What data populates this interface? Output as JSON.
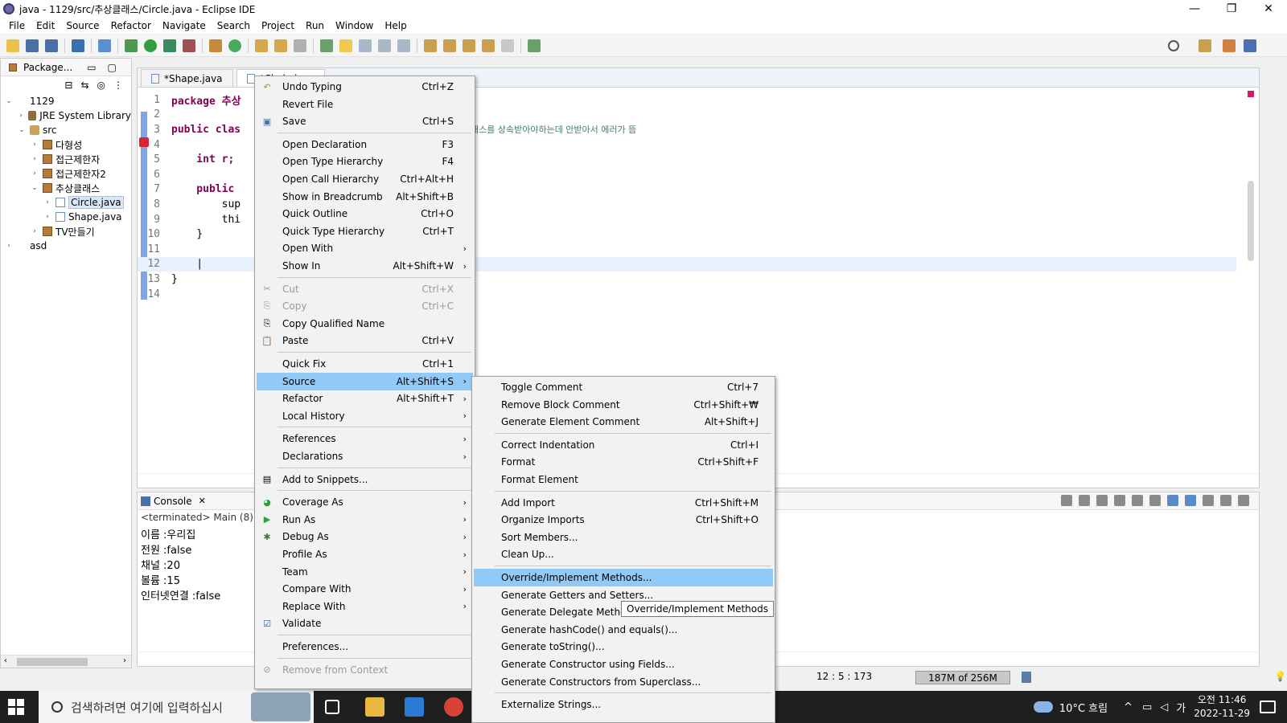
{
  "window": {
    "title": "java - 1129/src/추상클래스/Circle.java - Eclipse IDE"
  },
  "menubar": [
    "File",
    "Edit",
    "Source",
    "Refactor",
    "Navigate",
    "Search",
    "Project",
    "Run",
    "Window",
    "Help"
  ],
  "package_explorer": {
    "title": "Package...",
    "tree": [
      {
        "label": "1129",
        "indent": 0,
        "arrow": "v",
        "icon": "project"
      },
      {
        "label": "JRE System Library",
        "indent": 1,
        "arrow": ">",
        "icon": "lib"
      },
      {
        "label": "src",
        "indent": 1,
        "arrow": "v",
        "icon": "src"
      },
      {
        "label": "다형성",
        "indent": 2,
        "arrow": ">",
        "icon": "pkg"
      },
      {
        "label": "접근제한자",
        "indent": 2,
        "arrow": ">",
        "icon": "pkg"
      },
      {
        "label": "접근제한자2",
        "indent": 2,
        "arrow": ">",
        "icon": "pkg"
      },
      {
        "label": "추상클래스",
        "indent": 2,
        "arrow": "v",
        "icon": "pkg"
      },
      {
        "label": "Circle.java",
        "indent": 3,
        "arrow": ">",
        "icon": "file",
        "selected": true
      },
      {
        "label": "Shape.java",
        "indent": 3,
        "arrow": ">",
        "icon": "file"
      },
      {
        "label": "TV만들기",
        "indent": 2,
        "arrow": ">",
        "icon": "pkg"
      },
      {
        "label": "asd",
        "indent": 0,
        "arrow": ">",
        "icon": "project"
      }
    ]
  },
  "editor": {
    "tabs": [
      "*Shape.java",
      "*Circle.java"
    ],
    "lines": [
      {
        "n": "1",
        "text": "package 추상"
      },
      {
        "n": "2",
        "text": ""
      },
      {
        "n": "3",
        "text": "public clas",
        "comment": "래스를 상속받아야하는데 안받아서 에러가 뜸"
      },
      {
        "n": "4",
        "text": ""
      },
      {
        "n": "5",
        "text": "    int r;"
      },
      {
        "n": "6",
        "text": ""
      },
      {
        "n": "7",
        "text": "    public"
      },
      {
        "n": "8",
        "text": "        sup"
      },
      {
        "n": "9",
        "text": "        thi"
      },
      {
        "n": "10",
        "text": "    }"
      },
      {
        "n": "11",
        "text": ""
      },
      {
        "n": "12",
        "text": "    |"
      },
      {
        "n": "13",
        "text": "}"
      },
      {
        "n": "14",
        "text": ""
      }
    ]
  },
  "console": {
    "title": "Console",
    "terminated": "<terminated> Main (8) [Ja",
    "lines": [
      "이름 :우리집",
      "전원 :false",
      "채널 :20",
      "볼륨 :15",
      "인터넷연결 :false"
    ]
  },
  "context_menu": {
    "items": [
      {
        "label": "Undo Typing",
        "shortcut": "Ctrl+Z",
        "icon": "undo-icon"
      },
      {
        "label": "Revert File",
        "shortcut": ""
      },
      {
        "label": "Save",
        "shortcut": "Ctrl+S",
        "icon": "save-icon"
      },
      {
        "sep": true
      },
      {
        "label": "Open Declaration",
        "shortcut": "F3"
      },
      {
        "label": "Open Type Hierarchy",
        "shortcut": "F4"
      },
      {
        "label": "Open Call Hierarchy",
        "shortcut": "Ctrl+Alt+H"
      },
      {
        "label": "Show in Breadcrumb",
        "shortcut": "Alt+Shift+B"
      },
      {
        "label": "Quick Outline",
        "shortcut": "Ctrl+O"
      },
      {
        "label": "Quick Type Hierarchy",
        "shortcut": "Ctrl+T"
      },
      {
        "label": "Open With",
        "shortcut": "",
        "submenu": true
      },
      {
        "label": "Show In",
        "shortcut": "Alt+Shift+W",
        "submenu": true
      },
      {
        "sep": true
      },
      {
        "label": "Cut",
        "shortcut": "Ctrl+X",
        "disabled": true,
        "icon": "cut-icon"
      },
      {
        "label": "Copy",
        "shortcut": "Ctrl+C",
        "disabled": true,
        "icon": "copy-icon"
      },
      {
        "label": "Copy Qualified Name",
        "shortcut": "",
        "icon": "copy-qualified-icon"
      },
      {
        "label": "Paste",
        "shortcut": "Ctrl+V",
        "icon": "paste-icon"
      },
      {
        "sep": true
      },
      {
        "label": "Quick Fix",
        "shortcut": "Ctrl+1"
      },
      {
        "label": "Source",
        "shortcut": "Alt+Shift+S",
        "submenu": true,
        "highlight": true
      },
      {
        "label": "Refactor",
        "shortcut": "Alt+Shift+T",
        "submenu": true
      },
      {
        "label": "Local History",
        "shortcut": "",
        "submenu": true
      },
      {
        "sep": true
      },
      {
        "label": "References",
        "shortcut": "",
        "submenu": true
      },
      {
        "label": "Declarations",
        "shortcut": "",
        "submenu": true
      },
      {
        "sep": true
      },
      {
        "label": "Add to Snippets...",
        "shortcut": "",
        "icon": "snippet-icon"
      },
      {
        "sep": true
      },
      {
        "label": "Coverage As",
        "shortcut": "",
        "submenu": true,
        "icon": "coverage-icon"
      },
      {
        "label": "Run As",
        "shortcut": "",
        "submenu": true,
        "icon": "run-icon"
      },
      {
        "label": "Debug As",
        "shortcut": "",
        "submenu": true,
        "icon": "debug-icon"
      },
      {
        "label": "Profile As",
        "shortcut": "",
        "submenu": true
      },
      {
        "label": "Team",
        "shortcut": "",
        "submenu": true
      },
      {
        "label": "Compare With",
        "shortcut": "",
        "submenu": true
      },
      {
        "label": "Replace With",
        "shortcut": "",
        "submenu": true
      },
      {
        "label": "Validate",
        "shortcut": "",
        "icon": "check-icon"
      },
      {
        "sep": true
      },
      {
        "label": "Preferences...",
        "shortcut": ""
      },
      {
        "sep": true
      },
      {
        "label": "Remove from Context",
        "shortcut": "",
        "disabled": true,
        "icon": "remove-context-icon"
      }
    ]
  },
  "source_submenu": {
    "items": [
      {
        "label": "Toggle Comment",
        "shortcut": "Ctrl+7"
      },
      {
        "label": "Remove Block Comment",
        "shortcut": "Ctrl+Shift+₩"
      },
      {
        "label": "Generate Element Comment",
        "shortcut": "Alt+Shift+J"
      },
      {
        "sep": true
      },
      {
        "label": "Correct Indentation",
        "shortcut": "Ctrl+I"
      },
      {
        "label": "Format",
        "shortcut": "Ctrl+Shift+F"
      },
      {
        "label": "Format Element",
        "shortcut": ""
      },
      {
        "sep": true
      },
      {
        "label": "Add Import",
        "shortcut": "Ctrl+Shift+M"
      },
      {
        "label": "Organize Imports",
        "shortcut": "Ctrl+Shift+O"
      },
      {
        "label": "Sort Members...",
        "shortcut": ""
      },
      {
        "label": "Clean Up...",
        "shortcut": ""
      },
      {
        "sep": true
      },
      {
        "label": "Override/Implement Methods...",
        "shortcut": "",
        "highlight": true
      },
      {
        "label": "Generate Getters and Setters...",
        "shortcut": ""
      },
      {
        "label": "Generate Delegate Methods...",
        "shortcut": ""
      },
      {
        "label": "Generate hashCode() and equals()...",
        "shortcut": ""
      },
      {
        "label": "Generate toString()...",
        "shortcut": ""
      },
      {
        "label": "Generate Constructor using Fields...",
        "shortcut": ""
      },
      {
        "label": "Generate Constructors from Superclass...",
        "shortcut": ""
      },
      {
        "sep": true
      },
      {
        "label": "Externalize Strings...",
        "shortcut": ""
      }
    ]
  },
  "tooltip": "Override/Implement Methods",
  "status": {
    "position": "12 : 5 : 173",
    "heap": "187M of 256M"
  },
  "taskbar": {
    "search_placeholder": "검색하려면 여기에 입력하십시",
    "weather": "10°C 흐림",
    "ime": "가",
    "time": "오전 11:46",
    "date": "2022-11-29"
  }
}
